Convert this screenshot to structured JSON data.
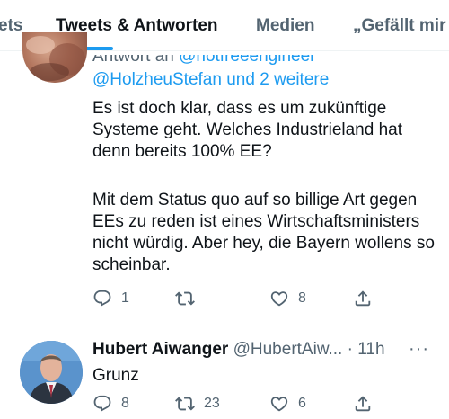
{
  "tabs": [
    {
      "label": "ets",
      "active": false
    },
    {
      "label": "Tweets & Antworten",
      "active": true
    },
    {
      "label": "Medien",
      "active": false
    },
    {
      "label": "„Gefällt mir",
      "active": false
    }
  ],
  "tweet1": {
    "reply_to_prefix": "Antwort an",
    "reply_to_handle": "@hotfreeengineer",
    "reply_mentions": "@HolzheuStefan",
    "reply_others": "und 2 weitere",
    "paragraphs": [
      "Es ist doch klar, dass es um zukünftige Systeme geht. Welches Industrieland hat denn bereits 100% EE?",
      "Mit dem Status quo auf so billige Art gegen EEs zu reden ist eines Wirtschaftsministers nicht würdig. Aber hey, die Bayern wollens so scheinbar."
    ],
    "reply_count": "1",
    "retweet_count": "",
    "like_count": "8"
  },
  "tweet2": {
    "name": "Hubert Aiwanger",
    "handle": "@HubertAiw...",
    "time": "11h",
    "text": "Grunz",
    "reply_count": "8",
    "retweet_count": "23",
    "like_count": "6"
  },
  "colors": {
    "accent": "#1d9bf0",
    "text": "#0f1419",
    "secondary": "#536471",
    "divider": "#eff3f4"
  },
  "icons": [
    "reply-icon",
    "retweet-icon",
    "like-icon",
    "share-icon",
    "more-icon"
  ]
}
